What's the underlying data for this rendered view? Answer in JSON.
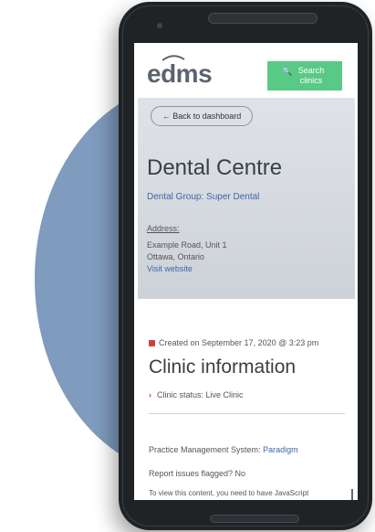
{
  "header": {
    "logo_text": "edms",
    "search_label_line1": "Search",
    "search_label_line2": "clinics",
    "search_icon": "search-icon"
  },
  "hero": {
    "back_label": "← Back to dashboard",
    "title": "Dental Centre",
    "group_link": "Dental Group: Super Dental",
    "address_label": "Address:",
    "address_line1": "Example Road, Unit 1",
    "address_line2": "Ottawa, Ontario",
    "visit_link": "Visit website"
  },
  "info": {
    "created": "Created on September 17, 2020 @ 3:23 pm",
    "section_title": "Clinic information",
    "status": "Clinic status: Live Clinic",
    "pms_label": "Practice Management System:",
    "pms_value": "Paradigm",
    "issues": "Report issues flagged? No",
    "js_note": "To view this content, you need to have JavaScript"
  },
  "colors": {
    "accent_green": "#59c986",
    "link_blue": "#3d66a8",
    "icon_red": "#c9423c",
    "background_circle": "#7f9bbd"
  }
}
